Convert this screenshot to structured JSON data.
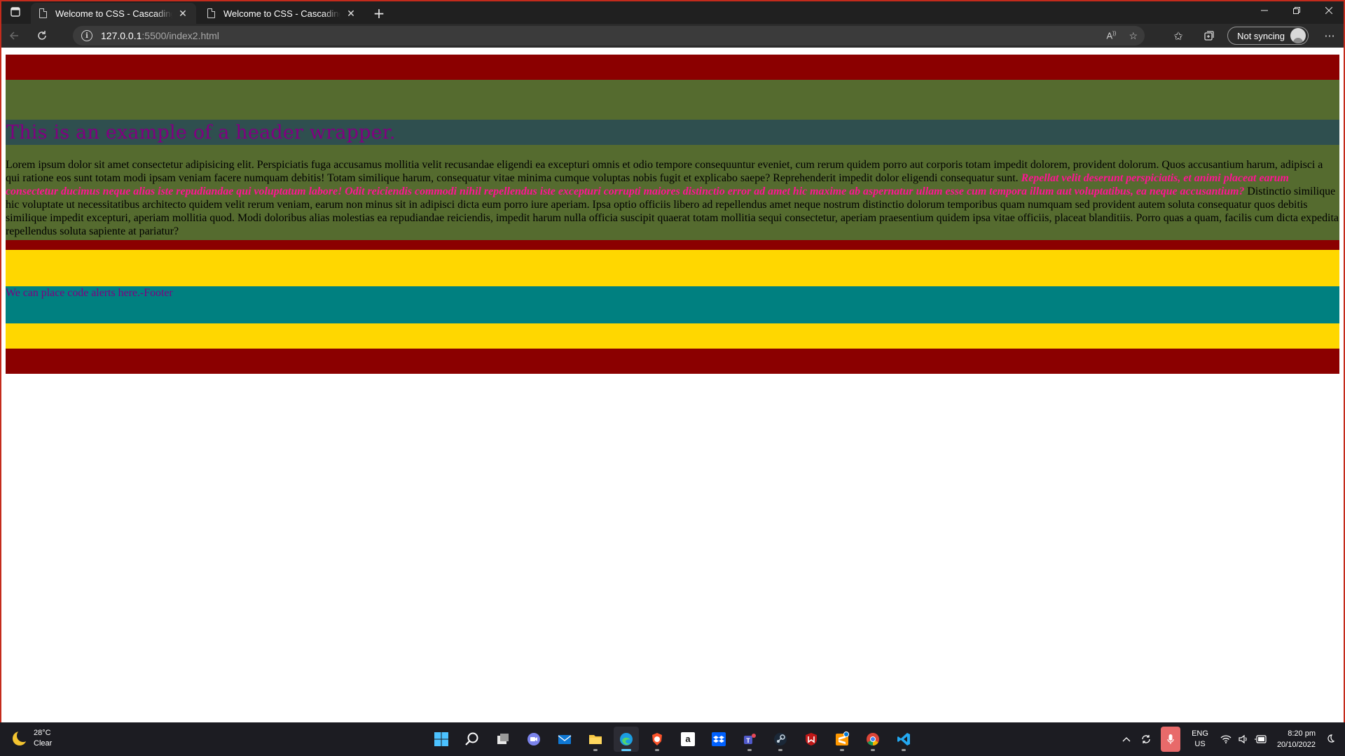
{
  "browser": {
    "tabs": [
      {
        "title": "Welcome to CSS - Cascading Style Sheets",
        "active": true
      },
      {
        "title": "Welcome to CSS - Cascading style sheets",
        "active": false
      }
    ],
    "url_host": "127.0.0.1",
    "url_path": ":5500/index2.html",
    "profile_label": "Not syncing",
    "icons": {
      "tab_actions": "tab-actions-icon",
      "new_tab": "plus-icon",
      "minimize": "minimize-icon",
      "restore": "restore-icon",
      "close": "close-icon",
      "back": "back-arrow-icon",
      "reload": "reload-icon",
      "site_info": "info-icon",
      "read_aloud": "read-aloud-icon",
      "add_favorite": "star-add-icon",
      "favorites": "favorites-icon",
      "collections": "collections-icon",
      "more": "more-icon"
    },
    "colors": {
      "frame_border": "#c42b1c",
      "tab_bg": "#202020",
      "toolbar_bg": "#2b2b2b"
    }
  },
  "page": {
    "header_text": "This is an example of a header wrapper.",
    "content": {
      "text1": "Lorem ipsum dolor sit amet consectetur adipisicing elit. Perspiciatis fuga accusamus mollitia velit recusandae eligendi ea excepturi omnis et odio tempore consequuntur eveniet, cum rerum quidem porro aut corporis totam impedit dolorem, provident dolorum. Quos accusantium harum, adipisci a qui ratione eos sunt totam modi ipsam veniam facere numquam debitis! Totam similique harum, consequatur vitae minima cumque voluptas nobis fugit et explicabo saepe? Reprehenderit impedit dolor eligendi consequatur sunt.",
      "emphasis": "Repellat velit deserunt perspiciatis, et animi placeat earum consectetur ducimus neque alias iste repudiandae qui voluptatum labore! Odit reiciendis commodi nihil repellendus iste excepturi corrupti maiores distinctio error ad amet hic maxime ab aspernatur ullam esse cum tempora illum aut voluptatibus, ea neque accusantium?",
      "text2": " Distinctio similique hic voluptate ut necessitatibus architecto quidem velit rerum veniam, earum non minus sit in adipisci dicta eum porro iure aperiam. Ipsa optio officiis libero ad repellendus amet neque nostrum distinctio dolorum temporibus quam numquam sed provident autem soluta consequatur quos debitis similique impedit excepturi, aperiam mollitia quod. Modi doloribus alias molestias ea repudiandae reiciendis, impedit harum nulla officia suscipit quaerat totam mollitia sequi consectetur, aperiam praesentium quidem ipsa vitae officiis, placeat blanditiis. Porro quas a quam, facilis cum dicta expedita repellendus soluta sapiente at pariatur?"
    },
    "footer_text": "We can place code alerts here.-Footer",
    "colors": {
      "red": "#8b0000",
      "olive": "#556b2f",
      "slate": "#2f4f4f",
      "gold": "#ffd700",
      "teal": "#008080",
      "purple": "#800080",
      "pink": "#ff1493"
    }
  },
  "taskbar": {
    "weather_temp": "28°C",
    "weather_desc": "Clear",
    "apps": [
      {
        "name": "start-icon",
        "active": false
      },
      {
        "name": "search-icon",
        "active": false
      },
      {
        "name": "task-view-icon",
        "active": false
      },
      {
        "name": "chat-icon",
        "active": false
      },
      {
        "name": "mail-icon",
        "active": false
      },
      {
        "name": "file-explorer-icon",
        "active": false
      },
      {
        "name": "edge-icon",
        "active": true
      },
      {
        "name": "brave-icon",
        "active": false
      },
      {
        "name": "amazon-icon",
        "active": false
      },
      {
        "name": "dropbox-icon",
        "active": false
      },
      {
        "name": "teams-icon",
        "active": false
      },
      {
        "name": "steam-icon",
        "active": false
      },
      {
        "name": "mcafee-icon",
        "active": false
      },
      {
        "name": "sublime-icon",
        "active": false
      },
      {
        "name": "chrome-icon",
        "active": false
      },
      {
        "name": "vscode-icon",
        "active": false
      }
    ],
    "lang_top": "ENG",
    "lang_bottom": "US",
    "time": "8:20 pm",
    "date": "20/10/2022"
  }
}
